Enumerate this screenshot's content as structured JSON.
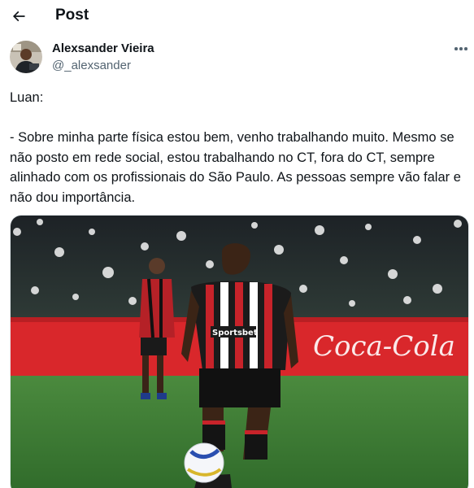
{
  "header": {
    "back_icon": "arrow-left-icon",
    "title": "Post"
  },
  "author": {
    "name": "Alexsander Vieira",
    "handle": "@_alexsander",
    "avatar_icon": "profile-photo"
  },
  "more_icon": "more-horizontal-icon",
  "tweet": {
    "text": "Luan:\n\n- Sobre minha parte física estou bem, venho trabalhando muito. Mesmo se não posto em rede social, estou trabalhando no CT, fora do CT, sempre alinhado com os profissionais do São Paulo. As pessoas sempre vão falar e não dou importância."
  },
  "media": {
    "board_text": "Coca-Cola",
    "shirt_sponsor": "Sportsbet"
  },
  "colors": {
    "text_primary": "#0f1419",
    "text_secondary": "#536471",
    "board_red": "#e1292c",
    "pitch_green": "#3f7a35"
  }
}
